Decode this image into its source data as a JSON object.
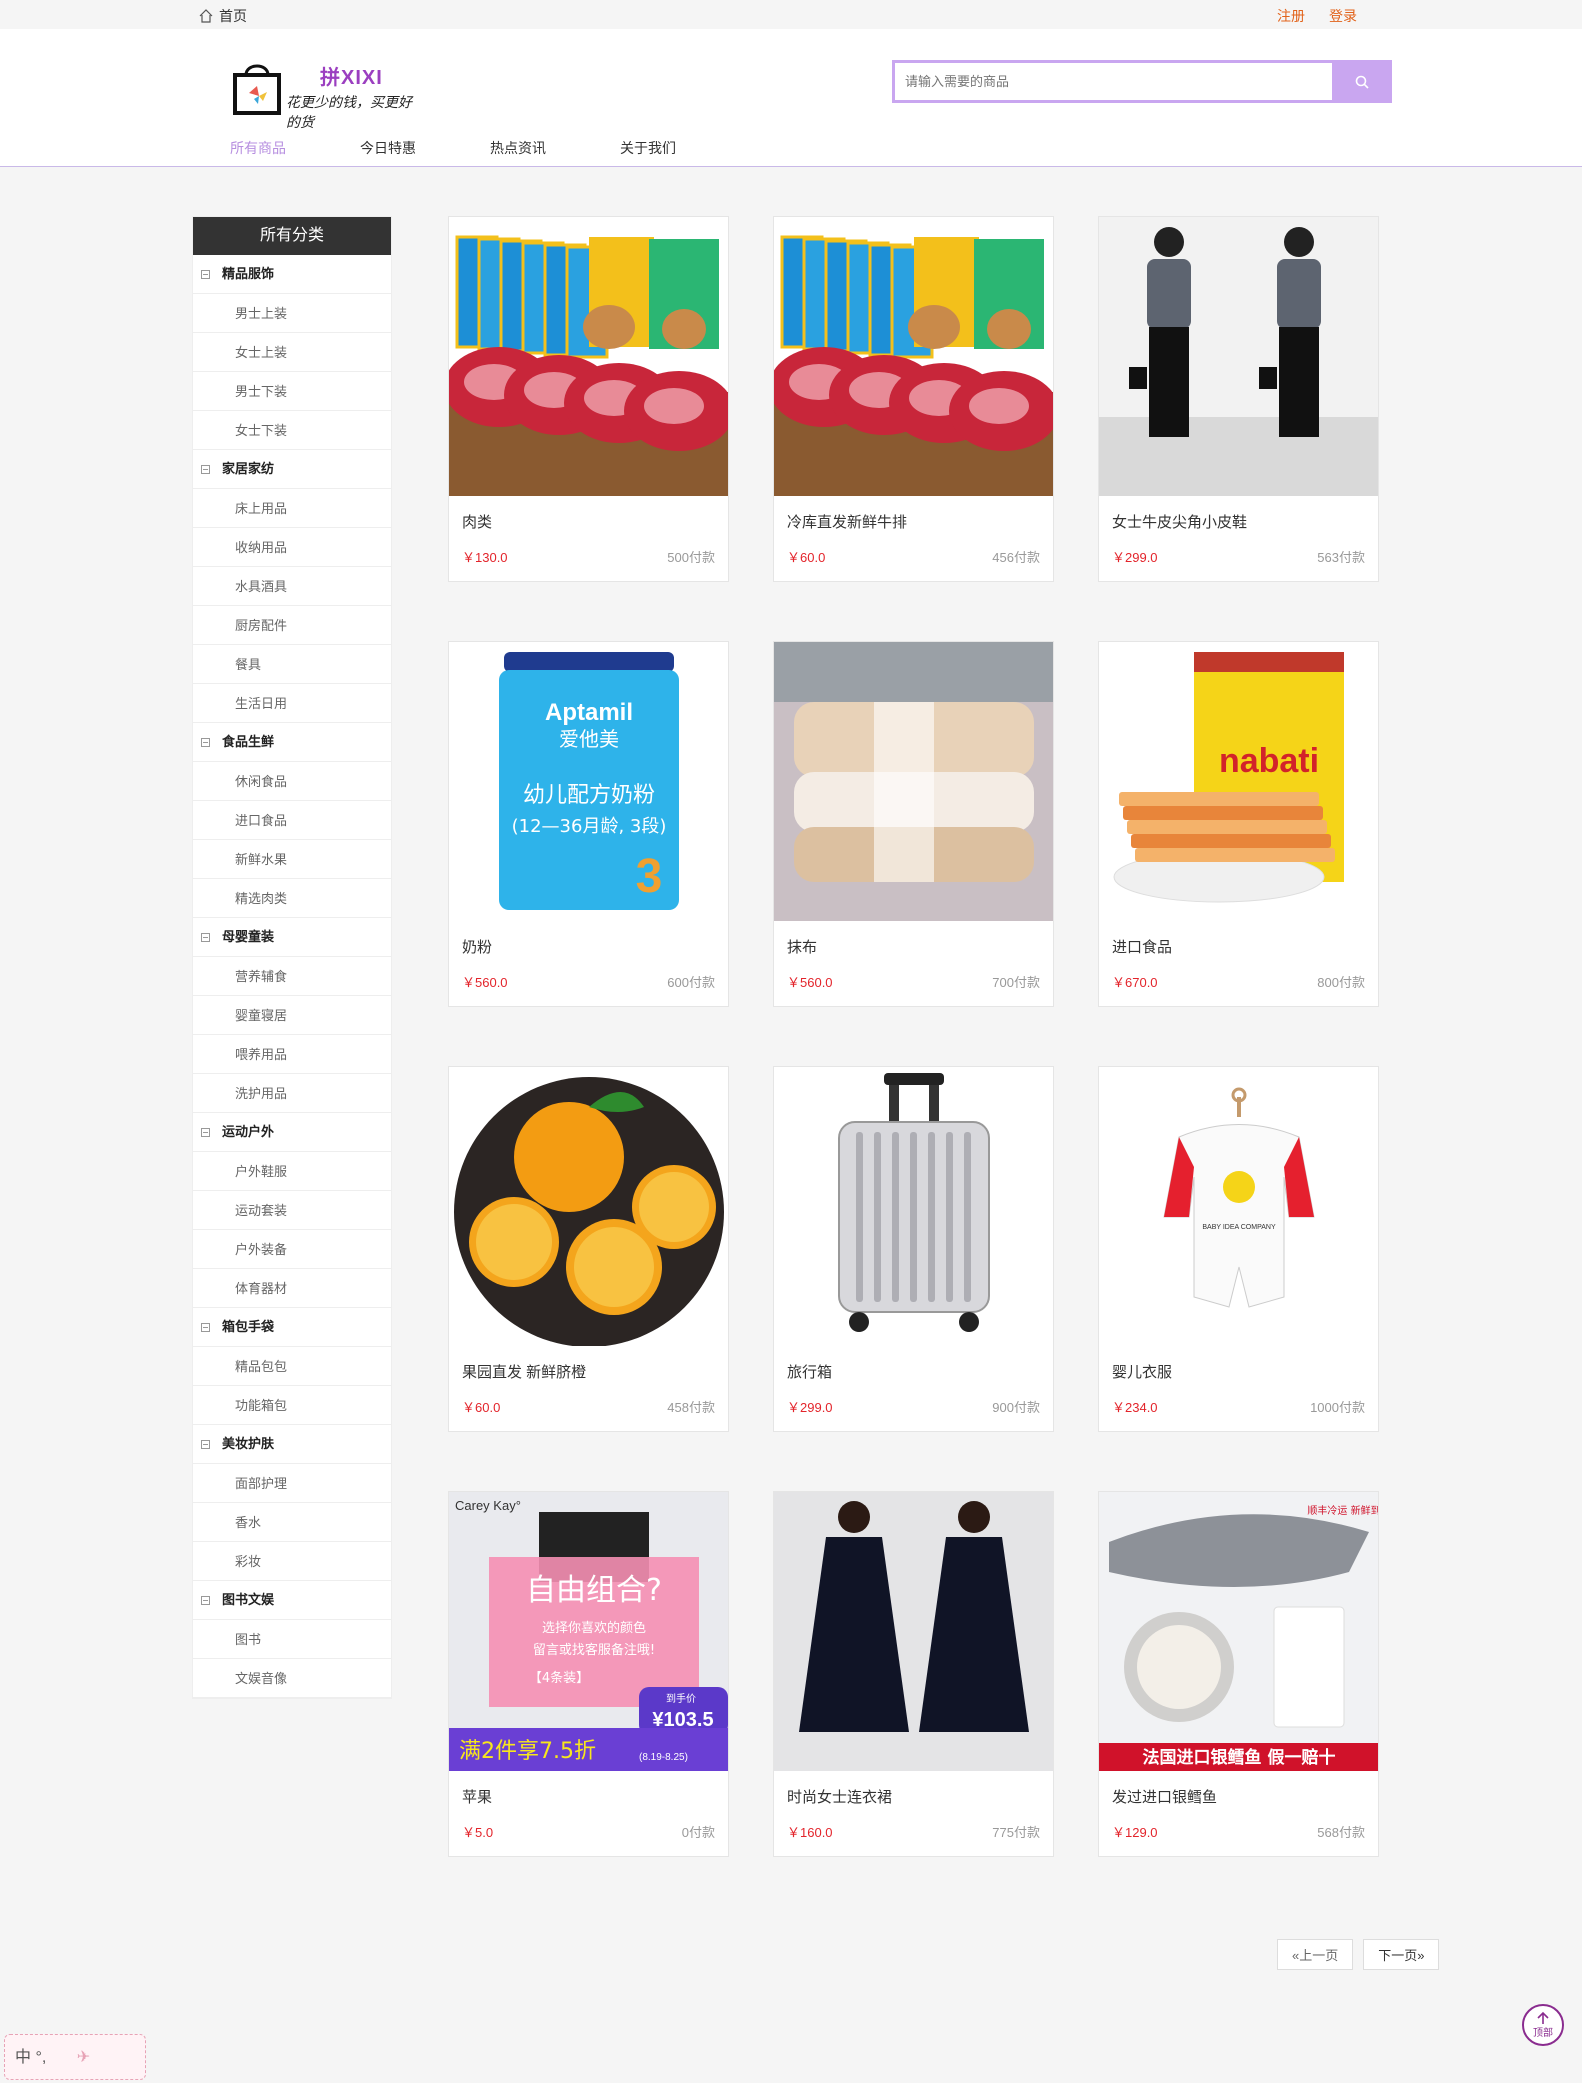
{
  "topbar": {
    "home": "首页",
    "register": "注册",
    "login": "登录"
  },
  "logo": {
    "title": "拼XIXI",
    "slogan": "花更少的钱，买更好的货"
  },
  "search": {
    "placeholder": "请输入需要的商品"
  },
  "nav": [
    "所有商品",
    "今日特惠",
    "热点资讯",
    "关于我们"
  ],
  "sidebar": {
    "title": "所有分类",
    "categories": [
      {
        "name": "精品服饰",
        "items": [
          "男士上装",
          "女士上装",
          "男士下装",
          "女士下装"
        ]
      },
      {
        "name": "家居家纺",
        "items": [
          "床上用品",
          "收纳用品",
          "水具酒具",
          "厨房配件",
          "餐具",
          "生活日用"
        ]
      },
      {
        "name": "食品生鲜",
        "items": [
          "休闲食品",
          "进口食品",
          "新鲜水果",
          "精选肉类"
        ]
      },
      {
        "name": "母婴童装",
        "items": [
          "营养辅食",
          "婴童寝居",
          "喂养用品",
          "洗护用品"
        ]
      },
      {
        "name": "运动户外",
        "items": [
          "户外鞋服",
          "运动套装",
          "户外装备",
          "体育器材"
        ]
      },
      {
        "name": "箱包手袋",
        "items": [
          "精品包包",
          "功能箱包"
        ]
      },
      {
        "name": "美妆护肤",
        "items": [
          "面部护理",
          "香水",
          "彩妆"
        ]
      },
      {
        "name": "图书文娱",
        "items": [
          "图书",
          "文娱音像"
        ]
      }
    ]
  },
  "products": [
    {
      "name": "肉类",
      "price": "￥130.0",
      "sold": "500付款",
      "icon": "steak-image"
    },
    {
      "name": "冷库直发新鲜牛排",
      "price": "￥60.0",
      "sold": "456付款",
      "icon": "steak-image"
    },
    {
      "name": "女士牛皮尖角小皮鞋",
      "price": "￥299.0",
      "sold": "563付款",
      "icon": "fashion-image"
    },
    {
      "name": "奶粉",
      "price": "￥560.0",
      "sold": "600付款",
      "icon": "milk-powder-image"
    },
    {
      "name": "抹布",
      "price": "￥560.0",
      "sold": "700付款",
      "icon": "quilt-image"
    },
    {
      "name": "进口食品",
      "price": "￥670.0",
      "sold": "800付款",
      "icon": "wafer-image"
    },
    {
      "name": "果园直发 新鲜脐橙",
      "price": "￥60.0",
      "sold": "458付款",
      "icon": "orange-image"
    },
    {
      "name": "旅行箱",
      "price": "￥299.0",
      "sold": "900付款",
      "icon": "suitcase-image"
    },
    {
      "name": "婴儿衣服",
      "price": "￥234.0",
      "sold": "1000付款",
      "icon": "baby-clothes-image"
    },
    {
      "name": "苹果",
      "price": "￥5.0",
      "sold": "0付款",
      "icon": "ad-image"
    },
    {
      "name": "时尚女士连衣裙",
      "price": "￥160.0",
      "sold": "775付款",
      "icon": "dress-image"
    },
    {
      "name": "发过进口银鳕鱼",
      "price": "￥129.0",
      "sold": "568付款",
      "icon": "fish-image"
    }
  ],
  "product_image_text": {
    "milk_brand": "Aptamil",
    "milk_cn": "爱他美",
    "milk_desc": "幼儿配方奶粉",
    "milk_age": "(12—36月龄, 3段)",
    "wafer_brand": "nabati",
    "ad_brand": "Carey Kay°",
    "ad_title": "自由组合?",
    "ad_line1": "选择你喜欢的颜色",
    "ad_line2": "留言或找客服备注哦!",
    "ad_set": "【4条装】",
    "ad_price_label": "到手价",
    "ad_price": "¥103.5",
    "ad_promo": "满2件享7.5折",
    "ad_date": "(8.19-8.25)",
    "fish_banner": "法国进口银鳕鱼 假一赔十",
    "fish_tag": "顺丰冷运 新鲜到家",
    "baby_logo": "BABY IDEA COMPANY"
  },
  "pager": {
    "prev": "«上一页",
    "next": "下一页»"
  },
  "totop": "顶部",
  "ime": "中 °,",
  "colors": {
    "accent": "#c9a6f0",
    "price": "#e3242b",
    "topLink": "#e2631b",
    "logo": "#9b3fc0"
  }
}
